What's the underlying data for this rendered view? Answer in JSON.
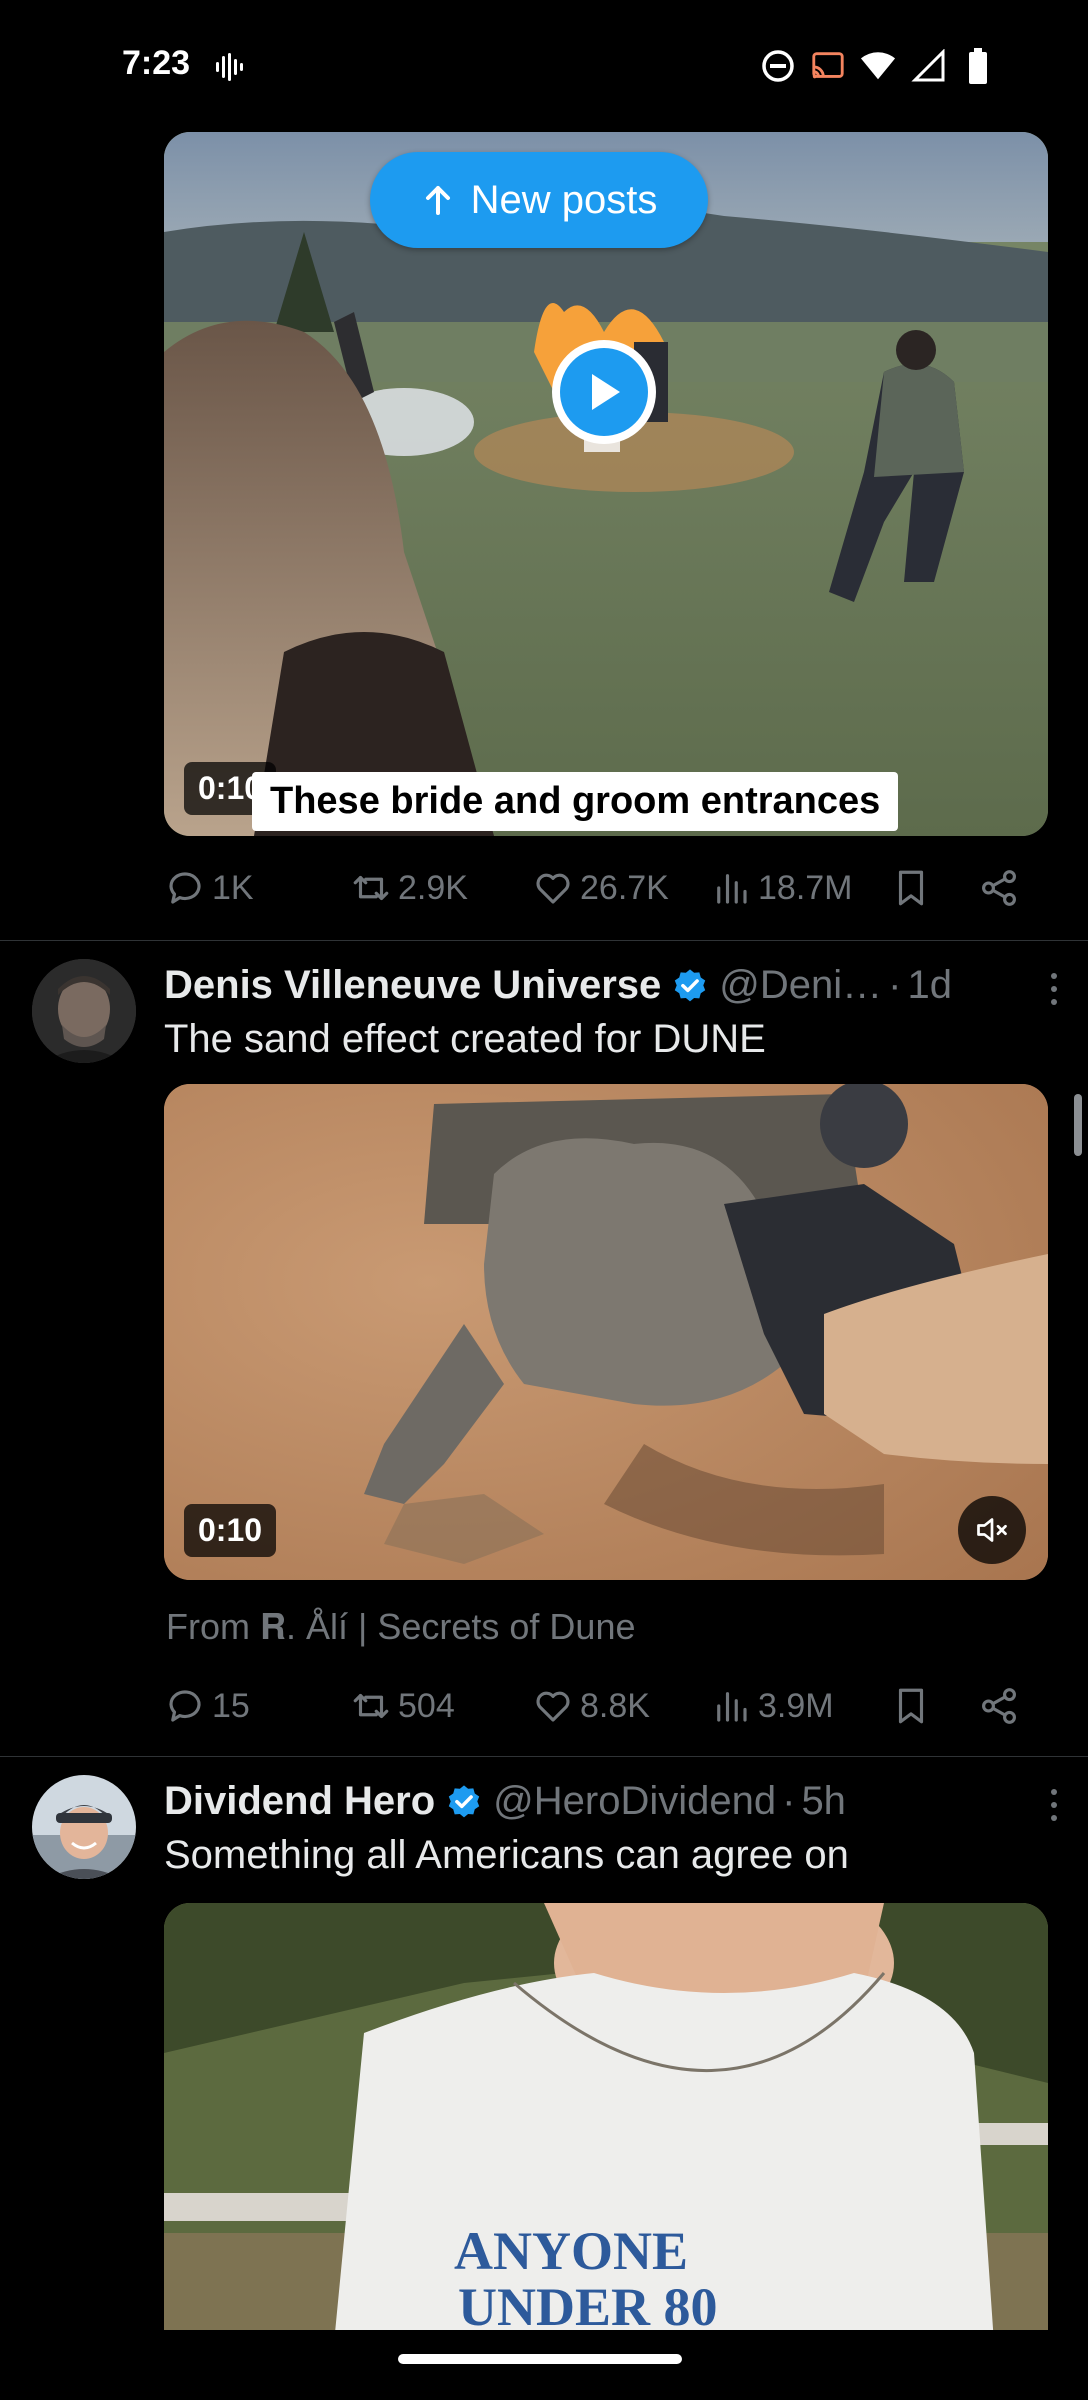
{
  "status_bar": {
    "time": "7:23",
    "icons": [
      "sound-wave-icon",
      "do-not-disturb-icon",
      "cast-icon",
      "wifi-icon",
      "signal-icon",
      "battery-icon"
    ]
  },
  "new_posts": {
    "label": "New posts",
    "icon": "arrow-up-icon"
  },
  "posts": [
    {
      "media": {
        "type": "video",
        "duration": "0:10",
        "caption": "These bride and groom entrances",
        "play_icon": "play-icon"
      },
      "stats": {
        "replies": "1K",
        "reposts": "2.9K",
        "likes": "26.7K",
        "views": "18.7M"
      }
    },
    {
      "author": "Denis Villeneuve Universe",
      "verified": true,
      "handle": "@Deni…",
      "age": "1d",
      "text": "The sand effect created for DUNE",
      "media": {
        "type": "video",
        "duration": "0:10",
        "muted": true
      },
      "source": "From 𝐑. Ålí | Secrets of Dune",
      "stats": {
        "replies": "15",
        "reposts": "504",
        "likes": "8.8K",
        "views": "3.9M"
      }
    },
    {
      "author": "Dividend Hero",
      "verified": true,
      "handle": "@HeroDividend",
      "age": "5h",
      "text": "Something all Americans can agree on",
      "media": {
        "type": "image",
        "shirt_text_line1": "ANYONE",
        "shirt_text_line2": "UNDER 80"
      }
    }
  ],
  "colors": {
    "accent": "#1d9bf0",
    "muted_text": "#71767b",
    "divider": "#2f3336",
    "background": "#000000"
  }
}
